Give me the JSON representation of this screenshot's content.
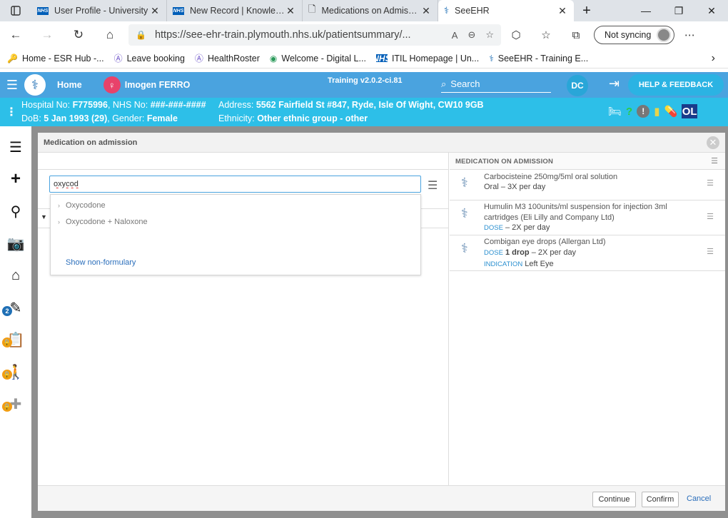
{
  "browser": {
    "tabs": [
      {
        "title": "User Profile - University",
        "favicon": "nhs-icon"
      },
      {
        "title": "New Record | Knowledge",
        "favicon": "nhs-icon"
      },
      {
        "title": "Medications on Admission",
        "favicon": "page-icon"
      },
      {
        "title": "SeeEHR",
        "favicon": "seeehr-icon",
        "active": true
      }
    ],
    "url": "https://see-ehr-train.plymouth.nhs.uk/patientsummary/...",
    "sync_label": "Not syncing",
    "bookmarks": [
      {
        "label": "Home - ESR Hub -...",
        "icon": "key-icon"
      },
      {
        "label": "Leave booking",
        "icon": "a-icon"
      },
      {
        "label": "HealthRoster",
        "icon": "a-icon"
      },
      {
        "label": "Welcome - Digital L...",
        "icon": "digital-icon"
      },
      {
        "label": "ITIL Homepage | Un...",
        "icon": "nhs-icon"
      },
      {
        "label": "SeeEHR - Training E...",
        "icon": "seeehr-icon"
      }
    ]
  },
  "ehr": {
    "home_label": "Home",
    "patient_name": "Imogen FERRO",
    "version": "Training v2.0.2-ci.81",
    "search_label": "Search",
    "user_initials": "DC",
    "help_label": "HELP & FEEDBACK",
    "hospital_no_label": "Hospital No:",
    "hospital_no": "F775996",
    "nhs_no_label": "NHS No:",
    "nhs_no": "###-###-####",
    "dob_label": "DoB:",
    "dob": "5 Jan 1993 (29)",
    "gender_label": "Gender:",
    "gender": "Female",
    "address_label": "Address:",
    "address": "5562 Fairfield St #847, Ryde, Isle Of Wight, CW10 9GB",
    "ethnicity_label": "Ethnicity:",
    "ethnicity": "Other ethnic group - other",
    "ol_badge": "OL",
    "sidebar_badge": "2"
  },
  "modal": {
    "title": "Medication on admission",
    "search_value": "oxycod",
    "suggestions": [
      "Oxycodone",
      "Oxycodone + Naloxone"
    ],
    "show_non_formulary": "Show non-formulary",
    "right_title": "MEDICATION ON ADMISSION",
    "medications": [
      {
        "name": "Carbocisteine 250mg/5ml oral solution",
        "detail": "Oral – 3X per day"
      },
      {
        "name": "Humulin M3 100units/ml suspension for injection 3ml cartridges (Eli Lilly and Company Ltd)",
        "dose_label": "DOSE",
        "detail": "– 2X per day"
      },
      {
        "name": "Combigan eye drops (Allergan Ltd)",
        "dose_label": "DOSE",
        "dose_value": "1 drop",
        "detail": "– 2X per day",
        "indication_label": "INDICATION",
        "indication": "Left Eye"
      }
    ],
    "buttons": {
      "continue": "Continue",
      "confirm": "Confirm",
      "cancel": "Cancel"
    }
  }
}
